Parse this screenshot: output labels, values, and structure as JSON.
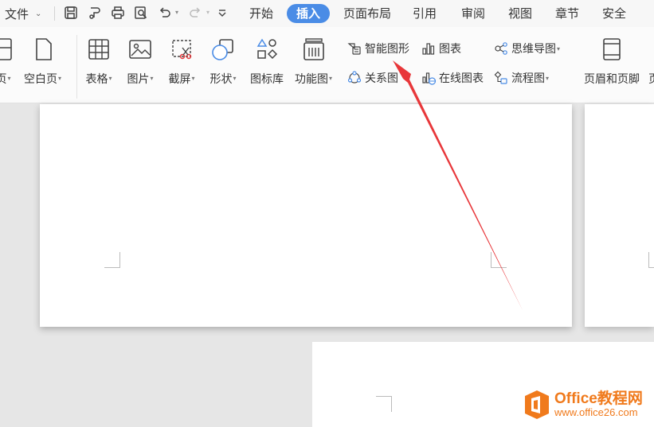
{
  "menubar": {
    "file_label": "文件",
    "quick_access": [
      "save-icon",
      "format-painter-icon",
      "print-icon",
      "print-preview-icon",
      "undo-icon",
      "redo-icon",
      "customize-icon"
    ],
    "tabs": [
      "开始",
      "插入",
      "页面布局",
      "引用",
      "审阅",
      "视图",
      "章节",
      "安全"
    ],
    "active_tab": "插入"
  },
  "ribbon": {
    "cut_page_label": "页",
    "blank_page_label": "空白页",
    "table_label": "表格",
    "picture_label": "图片",
    "screenshot_label": "截屏",
    "shape_label": "形状",
    "icon_library_label": "图标库",
    "function_chart_label": "功能图",
    "smart_art_label": "智能图形",
    "chart_label": "图表",
    "mind_map_label": "思维导图",
    "relation_label": "关系图",
    "online_chart_label": "在线图表",
    "flowchart_label": "流程图",
    "header_footer_label": "页眉和页脚"
  },
  "watermark": {
    "brand": "Office教程网",
    "url": "www.office26.com"
  },
  "colors": {
    "accent": "#4a8ce6",
    "arrow": "#e8373a",
    "watermark": "#f07a1c"
  }
}
